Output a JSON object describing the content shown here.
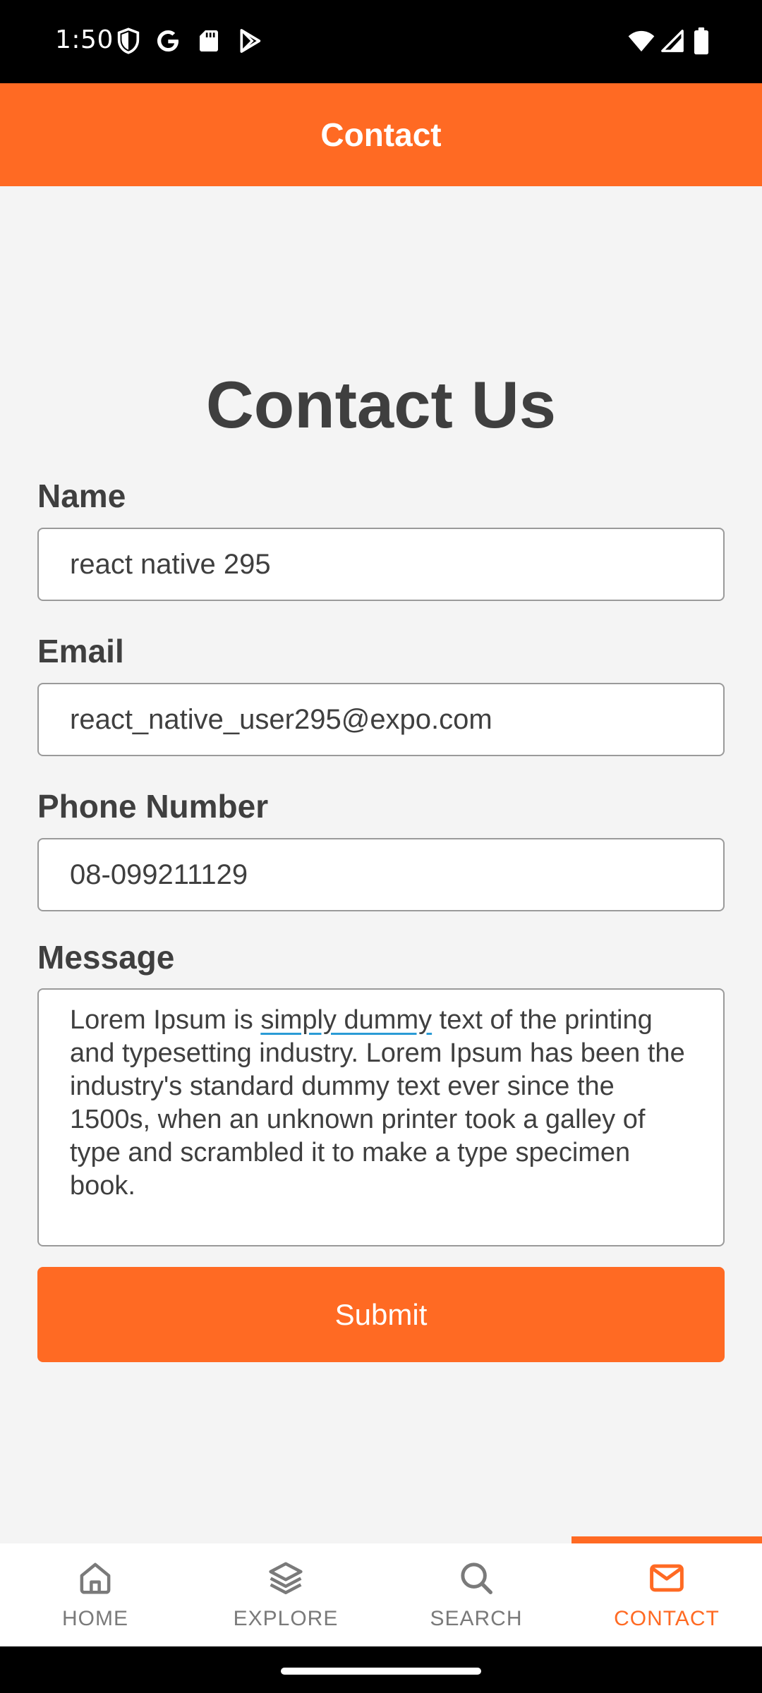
{
  "status_bar": {
    "time": "1:50",
    "icons": [
      "shield-icon",
      "google-icon",
      "sd-card-icon",
      "play-store-icon",
      "wifi-icon",
      "signal-icon",
      "battery-icon"
    ]
  },
  "header": {
    "title": "Contact"
  },
  "form": {
    "heading": "Contact Us",
    "name_label": "Name",
    "name_value": "react native 295",
    "email_label": "Email",
    "email_value": "react_native_user295@expo.com",
    "phone_label": "Phone Number",
    "phone_value": "08-099211129",
    "message_label": "Message",
    "message_part1": "Lorem Ipsum is ",
    "message_underlined": "simply dummy",
    "message_part2": " text of the printing and typesetting industry. Lorem Ipsum has been the industry's standard dummy text ever since the 1500s, when an unknown printer took a galley of type and scrambled it to make a type specimen book.",
    "submit_label": "Submit"
  },
  "bottom_nav": {
    "items": [
      {
        "label": "HOME",
        "icon": "home-icon",
        "active": false
      },
      {
        "label": "EXPLORE",
        "icon": "layers-icon",
        "active": false
      },
      {
        "label": "SEARCH",
        "icon": "search-icon",
        "active": false
      },
      {
        "label": "CONTACT",
        "icon": "mail-icon",
        "active": true
      }
    ]
  },
  "colors": {
    "accent": "#ff6a23",
    "text_dark": "#3f3f3f",
    "background": "#f4f4f4",
    "nav_inactive": "#7a7a7a"
  }
}
